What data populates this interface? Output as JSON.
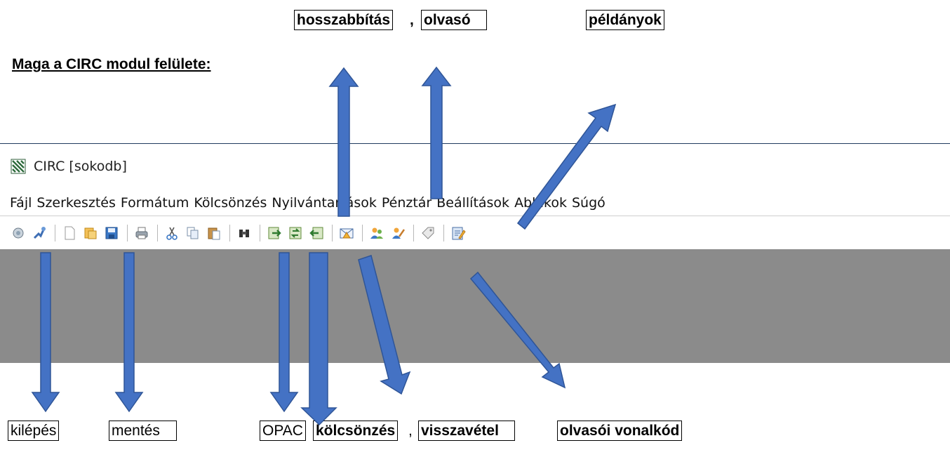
{
  "annotations": {
    "top": {
      "hosszabbitas": "hosszabbítás",
      "comma": ",",
      "olvaso": "olvasó",
      "peldanyok": "példányok"
    },
    "bottom": {
      "kilepes": "kilépés",
      "mentes": "mentés",
      "opac": "OPAC",
      "kolcsonzes": "kölcsönzés",
      "comma": ",",
      "visszavetel": "visszavétel",
      "olvasoi_vonalkod": "olvasói vonalkód"
    }
  },
  "heading": "Maga a CIRC modul felülete:",
  "window": {
    "app_icon": "circ-app-icon",
    "title": "CIRC [sokodb]"
  },
  "menu": {
    "items": [
      "Fájl",
      "Szerkesztés",
      "Formátum",
      "Kölcsönzés",
      "Nyilvántartások",
      "Pénztár",
      "Beállítások",
      "Ablakok",
      "Súgó"
    ]
  },
  "toolbar": {
    "icons": [
      "connect-icon",
      "exit-icon",
      "new-icon",
      "open-icon",
      "save-icon",
      "print-icon",
      "cut-icon",
      "copy-icon",
      "paste-icon",
      "opac-binoculars-icon",
      "loan-icon",
      "renew-icon",
      "return-icon",
      "message-icon",
      "reader-icon",
      "reader-barcode-icon",
      "tag-icon",
      "copies-icon"
    ]
  },
  "colors": {
    "arrow_fill": "#4472c4",
    "arrow_stroke": "#2f5597",
    "workspace": "#8b8b8b"
  }
}
